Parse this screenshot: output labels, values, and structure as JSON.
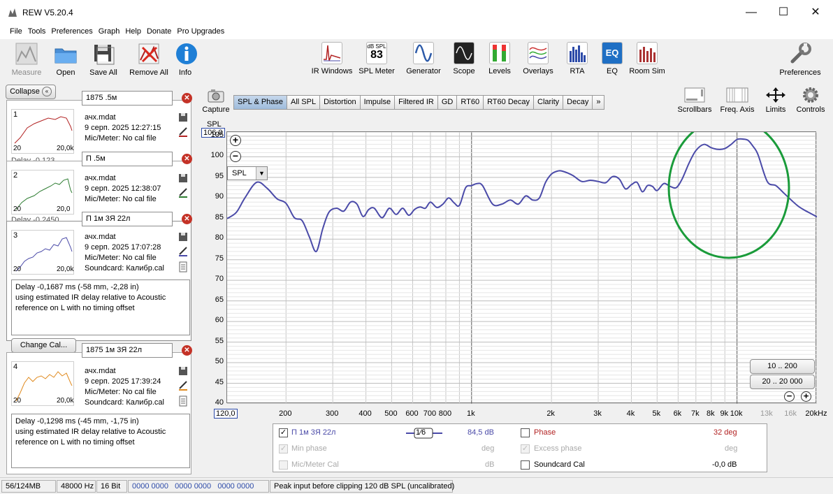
{
  "window": {
    "title": "REW V5.20.4",
    "min": "—",
    "max": "☐",
    "close": "✕"
  },
  "menu": [
    "File",
    "Tools",
    "Preferences",
    "Graph",
    "Help",
    "Donate",
    "Pro Upgrades"
  ],
  "toolbar": {
    "measure": "Measure",
    "open": "Open",
    "save_all": "Save All",
    "remove_all": "Remove All",
    "info": "Info",
    "ir_windows": "IR Windows",
    "spl_meter": "SPL Meter",
    "spl_meter_top": "dB SPL",
    "spl_meter_value": "83",
    "generator": "Generator",
    "scope": "Scope",
    "levels": "Levels",
    "overlays": "Overlays",
    "rta": "RTA",
    "eq": "EQ",
    "eq_icon_text": "EQ",
    "room_sim": "Room Sim",
    "preferences": "Preferences"
  },
  "left_panel": {
    "collapse": "Collapse",
    "measurements": [
      {
        "num": "1",
        "name": "1875 .5м",
        "file": "ачх.mdat",
        "date": "9 серп. 2025 12:27:15",
        "cal": "Mic/Meter: No cal file",
        "x_min": "20",
        "x_max": "20,0k",
        "color": "#b22222",
        "delay_peek": "Delay -0,123"
      },
      {
        "num": "2",
        "name": "П .5м",
        "file": "ачх.mdat",
        "date": "9 серп. 2025 12:38:07",
        "cal": "Mic/Meter: No cal file",
        "x_min": "20",
        "x_max": "20,0",
        "color": "#2e7d32",
        "delay_peek": "Delay -0,2450"
      },
      {
        "num": "3",
        "name": "П 1м 3Я 22л",
        "file": "ачх.mdat",
        "date": "9 серп. 2025 17:07:28",
        "cal": "Mic/Meter: No cal file",
        "cal2": "Soundcard: Калибр.cal",
        "x_min": "20",
        "x_max": "20,0k",
        "color": "#4a4aa8",
        "delay": [
          "Delay -0,1687 ms (-58 mm, -2,28 in)",
          "using estimated IR delay relative to Acoustic",
          "reference on  L with no timing offset"
        ],
        "change_cal": "Change Cal..."
      },
      {
        "num": "4",
        "name": "1875 1м 3Я 22л",
        "file": "ачх.mdat",
        "date": "9 серп. 2025 17:39:24",
        "cal": "Mic/Meter: No cal file",
        "cal2": "Soundcard: Калибр.cal",
        "x_min": "20",
        "x_max": "20,0k",
        "color": "#e08a1e",
        "delay": [
          "Delay -0,1298 ms (-45 mm, -1,75 in)",
          "using estimated IR delay relative to Acoustic",
          "reference on  L with no timing offset"
        ]
      }
    ]
  },
  "capture": "Capture",
  "tabs": [
    "SPL & Phase",
    "All SPL",
    "Distortion",
    "Impulse",
    "Filtered IR",
    "GD",
    "RT60",
    "RT60 Decay",
    "Clarity",
    "Decay",
    "»"
  ],
  "graph_controls": {
    "scrollbars": "Scrollbars",
    "freq_axis": "Freq. Axis",
    "limits": "Limits",
    "controls": "Controls"
  },
  "graph": {
    "y_label": "SPL",
    "y_top_value": "106,0",
    "x_left_value": "120,0",
    "unit_select": "SPL",
    "range_btn_1": "10 .. 200",
    "range_btn_2": "20 .. 20 000",
    "y_ticks": [
      "105",
      "100",
      "95",
      "90",
      "85",
      "80",
      "75",
      "70",
      "65",
      "60",
      "55",
      "50",
      "45",
      "40"
    ],
    "x_ticks": [
      "200",
      "300",
      "400",
      "500",
      "600",
      "700",
      "800",
      "1k",
      "2k",
      "3k",
      "4k",
      "5k",
      "6k",
      "7k",
      "8k",
      "9k",
      "10k",
      "13k",
      "16k",
      "20kHz"
    ]
  },
  "chart_data": {
    "type": "line",
    "xscale": "log",
    "xlim": [
      120,
      20000
    ],
    "ylim": [
      40,
      106
    ],
    "ylabel": "SPL",
    "series": [
      {
        "name": "П 1м 3Я 22л",
        "color": "#4a4aa8",
        "x": [
          120,
          130,
          140,
          155,
          170,
          185,
          200,
          215,
          230,
          245,
          260,
          275,
          290,
          310,
          330,
          350,
          370,
          390,
          410,
          430,
          460,
          490,
          520,
          550,
          580,
          610,
          640,
          670,
          700,
          740,
          780,
          820,
          860,
          900,
          950,
          1000,
          1050,
          1100,
          1200,
          1300,
          1400,
          1500,
          1600,
          1700,
          1800,
          1900,
          2000,
          2100,
          2200,
          2400,
          2600,
          2800,
          3000,
          3200,
          3400,
          3600,
          3800,
          4000,
          4200,
          4400,
          4600,
          4800,
          5000,
          5300,
          5600,
          5900,
          6200,
          6600,
          7000,
          7500,
          8000,
          8500,
          9000,
          9500,
          10000,
          10500,
          11000,
          11500,
          12000,
          13000,
          14000,
          15000,
          16000,
          17000,
          18000,
          19000,
          20000
        ],
        "y": [
          85,
          86.5,
          90,
          93.8,
          92.3,
          89.8,
          88.7,
          85.2,
          84.5,
          80.5,
          77,
          82.5,
          86.5,
          87.5,
          86.8,
          89,
          88.5,
          85.5,
          87.2,
          87.5,
          85.2,
          87.5,
          86,
          87.5,
          85.8,
          87.2,
          87.8,
          87.5,
          89,
          87.7,
          88.5,
          90,
          88.8,
          88.2,
          92.5,
          93,
          93.5,
          93,
          88.5,
          88.5,
          89.5,
          88.5,
          90.5,
          89.5,
          90,
          93.8,
          95.8,
          96.5,
          96.5,
          95.5,
          94,
          94.3,
          94,
          93.7,
          95.2,
          94.6,
          92.2,
          93.2,
          93.8,
          91.5,
          93,
          92.8,
          91.8,
          93.5,
          92.8,
          92.5,
          94.5,
          98.5,
          101.5,
          103,
          102.2,
          101.8,
          102,
          103,
          104.2,
          104.3,
          104,
          102.5,
          100.5,
          94,
          93,
          91.2,
          89.5,
          88,
          87,
          86.2,
          85.4
        ]
      }
    ]
  },
  "legend": {
    "trace_name": "П 1м 3Я 22л",
    "smoothing": "1⁄6",
    "trace_value": "84,5 dB",
    "phase": "Phase",
    "phase_value": "32 deg",
    "min_phase": "Min phase",
    "min_phase_unit": "deg",
    "excess_phase": "Excess phase",
    "excess_phase_unit": "deg",
    "mic_cal": "Mic/Meter Cal",
    "mic_cal_unit": "dB",
    "soundcard_cal": "Soundcard Cal",
    "soundcard_cal_value": "-0,0 dB"
  },
  "status": {
    "memory": "56/124MB",
    "rate": "48000 Hz",
    "bits": "16 Bit",
    "levels": "0000 0000   0000 0000   0000 0000",
    "message": "Peak input before clipping 120 dB SPL (uncalibrated)"
  },
  "colors": {
    "annotation": "#1a9b3a",
    "curve": "#4a4aa8",
    "tab_active": "#a9c4e4"
  }
}
